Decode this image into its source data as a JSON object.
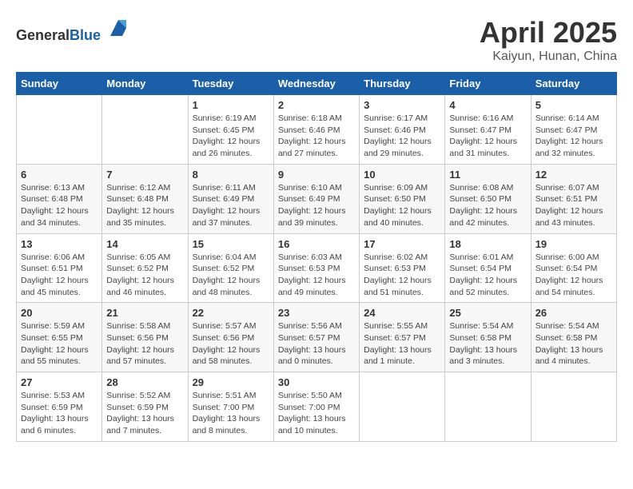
{
  "header": {
    "logo_general": "General",
    "logo_blue": "Blue",
    "title": "April 2025",
    "subtitle": "Kaiyun, Hunan, China"
  },
  "calendar": {
    "weekdays": [
      "Sunday",
      "Monday",
      "Tuesday",
      "Wednesday",
      "Thursday",
      "Friday",
      "Saturday"
    ],
    "weeks": [
      [
        {
          "day": "",
          "info": ""
        },
        {
          "day": "",
          "info": ""
        },
        {
          "day": "1",
          "info": "Sunrise: 6:19 AM\nSunset: 6:45 PM\nDaylight: 12 hours\nand 26 minutes."
        },
        {
          "day": "2",
          "info": "Sunrise: 6:18 AM\nSunset: 6:46 PM\nDaylight: 12 hours\nand 27 minutes."
        },
        {
          "day": "3",
          "info": "Sunrise: 6:17 AM\nSunset: 6:46 PM\nDaylight: 12 hours\nand 29 minutes."
        },
        {
          "day": "4",
          "info": "Sunrise: 6:16 AM\nSunset: 6:47 PM\nDaylight: 12 hours\nand 31 minutes."
        },
        {
          "day": "5",
          "info": "Sunrise: 6:14 AM\nSunset: 6:47 PM\nDaylight: 12 hours\nand 32 minutes."
        }
      ],
      [
        {
          "day": "6",
          "info": "Sunrise: 6:13 AM\nSunset: 6:48 PM\nDaylight: 12 hours\nand 34 minutes."
        },
        {
          "day": "7",
          "info": "Sunrise: 6:12 AM\nSunset: 6:48 PM\nDaylight: 12 hours\nand 35 minutes."
        },
        {
          "day": "8",
          "info": "Sunrise: 6:11 AM\nSunset: 6:49 PM\nDaylight: 12 hours\nand 37 minutes."
        },
        {
          "day": "9",
          "info": "Sunrise: 6:10 AM\nSunset: 6:49 PM\nDaylight: 12 hours\nand 39 minutes."
        },
        {
          "day": "10",
          "info": "Sunrise: 6:09 AM\nSunset: 6:50 PM\nDaylight: 12 hours\nand 40 minutes."
        },
        {
          "day": "11",
          "info": "Sunrise: 6:08 AM\nSunset: 6:50 PM\nDaylight: 12 hours\nand 42 minutes."
        },
        {
          "day": "12",
          "info": "Sunrise: 6:07 AM\nSunset: 6:51 PM\nDaylight: 12 hours\nand 43 minutes."
        }
      ],
      [
        {
          "day": "13",
          "info": "Sunrise: 6:06 AM\nSunset: 6:51 PM\nDaylight: 12 hours\nand 45 minutes."
        },
        {
          "day": "14",
          "info": "Sunrise: 6:05 AM\nSunset: 6:52 PM\nDaylight: 12 hours\nand 46 minutes."
        },
        {
          "day": "15",
          "info": "Sunrise: 6:04 AM\nSunset: 6:52 PM\nDaylight: 12 hours\nand 48 minutes."
        },
        {
          "day": "16",
          "info": "Sunrise: 6:03 AM\nSunset: 6:53 PM\nDaylight: 12 hours\nand 49 minutes."
        },
        {
          "day": "17",
          "info": "Sunrise: 6:02 AM\nSunset: 6:53 PM\nDaylight: 12 hours\nand 51 minutes."
        },
        {
          "day": "18",
          "info": "Sunrise: 6:01 AM\nSunset: 6:54 PM\nDaylight: 12 hours\nand 52 minutes."
        },
        {
          "day": "19",
          "info": "Sunrise: 6:00 AM\nSunset: 6:54 PM\nDaylight: 12 hours\nand 54 minutes."
        }
      ],
      [
        {
          "day": "20",
          "info": "Sunrise: 5:59 AM\nSunset: 6:55 PM\nDaylight: 12 hours\nand 55 minutes."
        },
        {
          "day": "21",
          "info": "Sunrise: 5:58 AM\nSunset: 6:56 PM\nDaylight: 12 hours\nand 57 minutes."
        },
        {
          "day": "22",
          "info": "Sunrise: 5:57 AM\nSunset: 6:56 PM\nDaylight: 12 hours\nand 58 minutes."
        },
        {
          "day": "23",
          "info": "Sunrise: 5:56 AM\nSunset: 6:57 PM\nDaylight: 13 hours\nand 0 minutes."
        },
        {
          "day": "24",
          "info": "Sunrise: 5:55 AM\nSunset: 6:57 PM\nDaylight: 13 hours\nand 1 minute."
        },
        {
          "day": "25",
          "info": "Sunrise: 5:54 AM\nSunset: 6:58 PM\nDaylight: 13 hours\nand 3 minutes."
        },
        {
          "day": "26",
          "info": "Sunrise: 5:54 AM\nSunset: 6:58 PM\nDaylight: 13 hours\nand 4 minutes."
        }
      ],
      [
        {
          "day": "27",
          "info": "Sunrise: 5:53 AM\nSunset: 6:59 PM\nDaylight: 13 hours\nand 6 minutes."
        },
        {
          "day": "28",
          "info": "Sunrise: 5:52 AM\nSunset: 6:59 PM\nDaylight: 13 hours\nand 7 minutes."
        },
        {
          "day": "29",
          "info": "Sunrise: 5:51 AM\nSunset: 7:00 PM\nDaylight: 13 hours\nand 8 minutes."
        },
        {
          "day": "30",
          "info": "Sunrise: 5:50 AM\nSunset: 7:00 PM\nDaylight: 13 hours\nand 10 minutes."
        },
        {
          "day": "",
          "info": ""
        },
        {
          "day": "",
          "info": ""
        },
        {
          "day": "",
          "info": ""
        }
      ]
    ]
  }
}
